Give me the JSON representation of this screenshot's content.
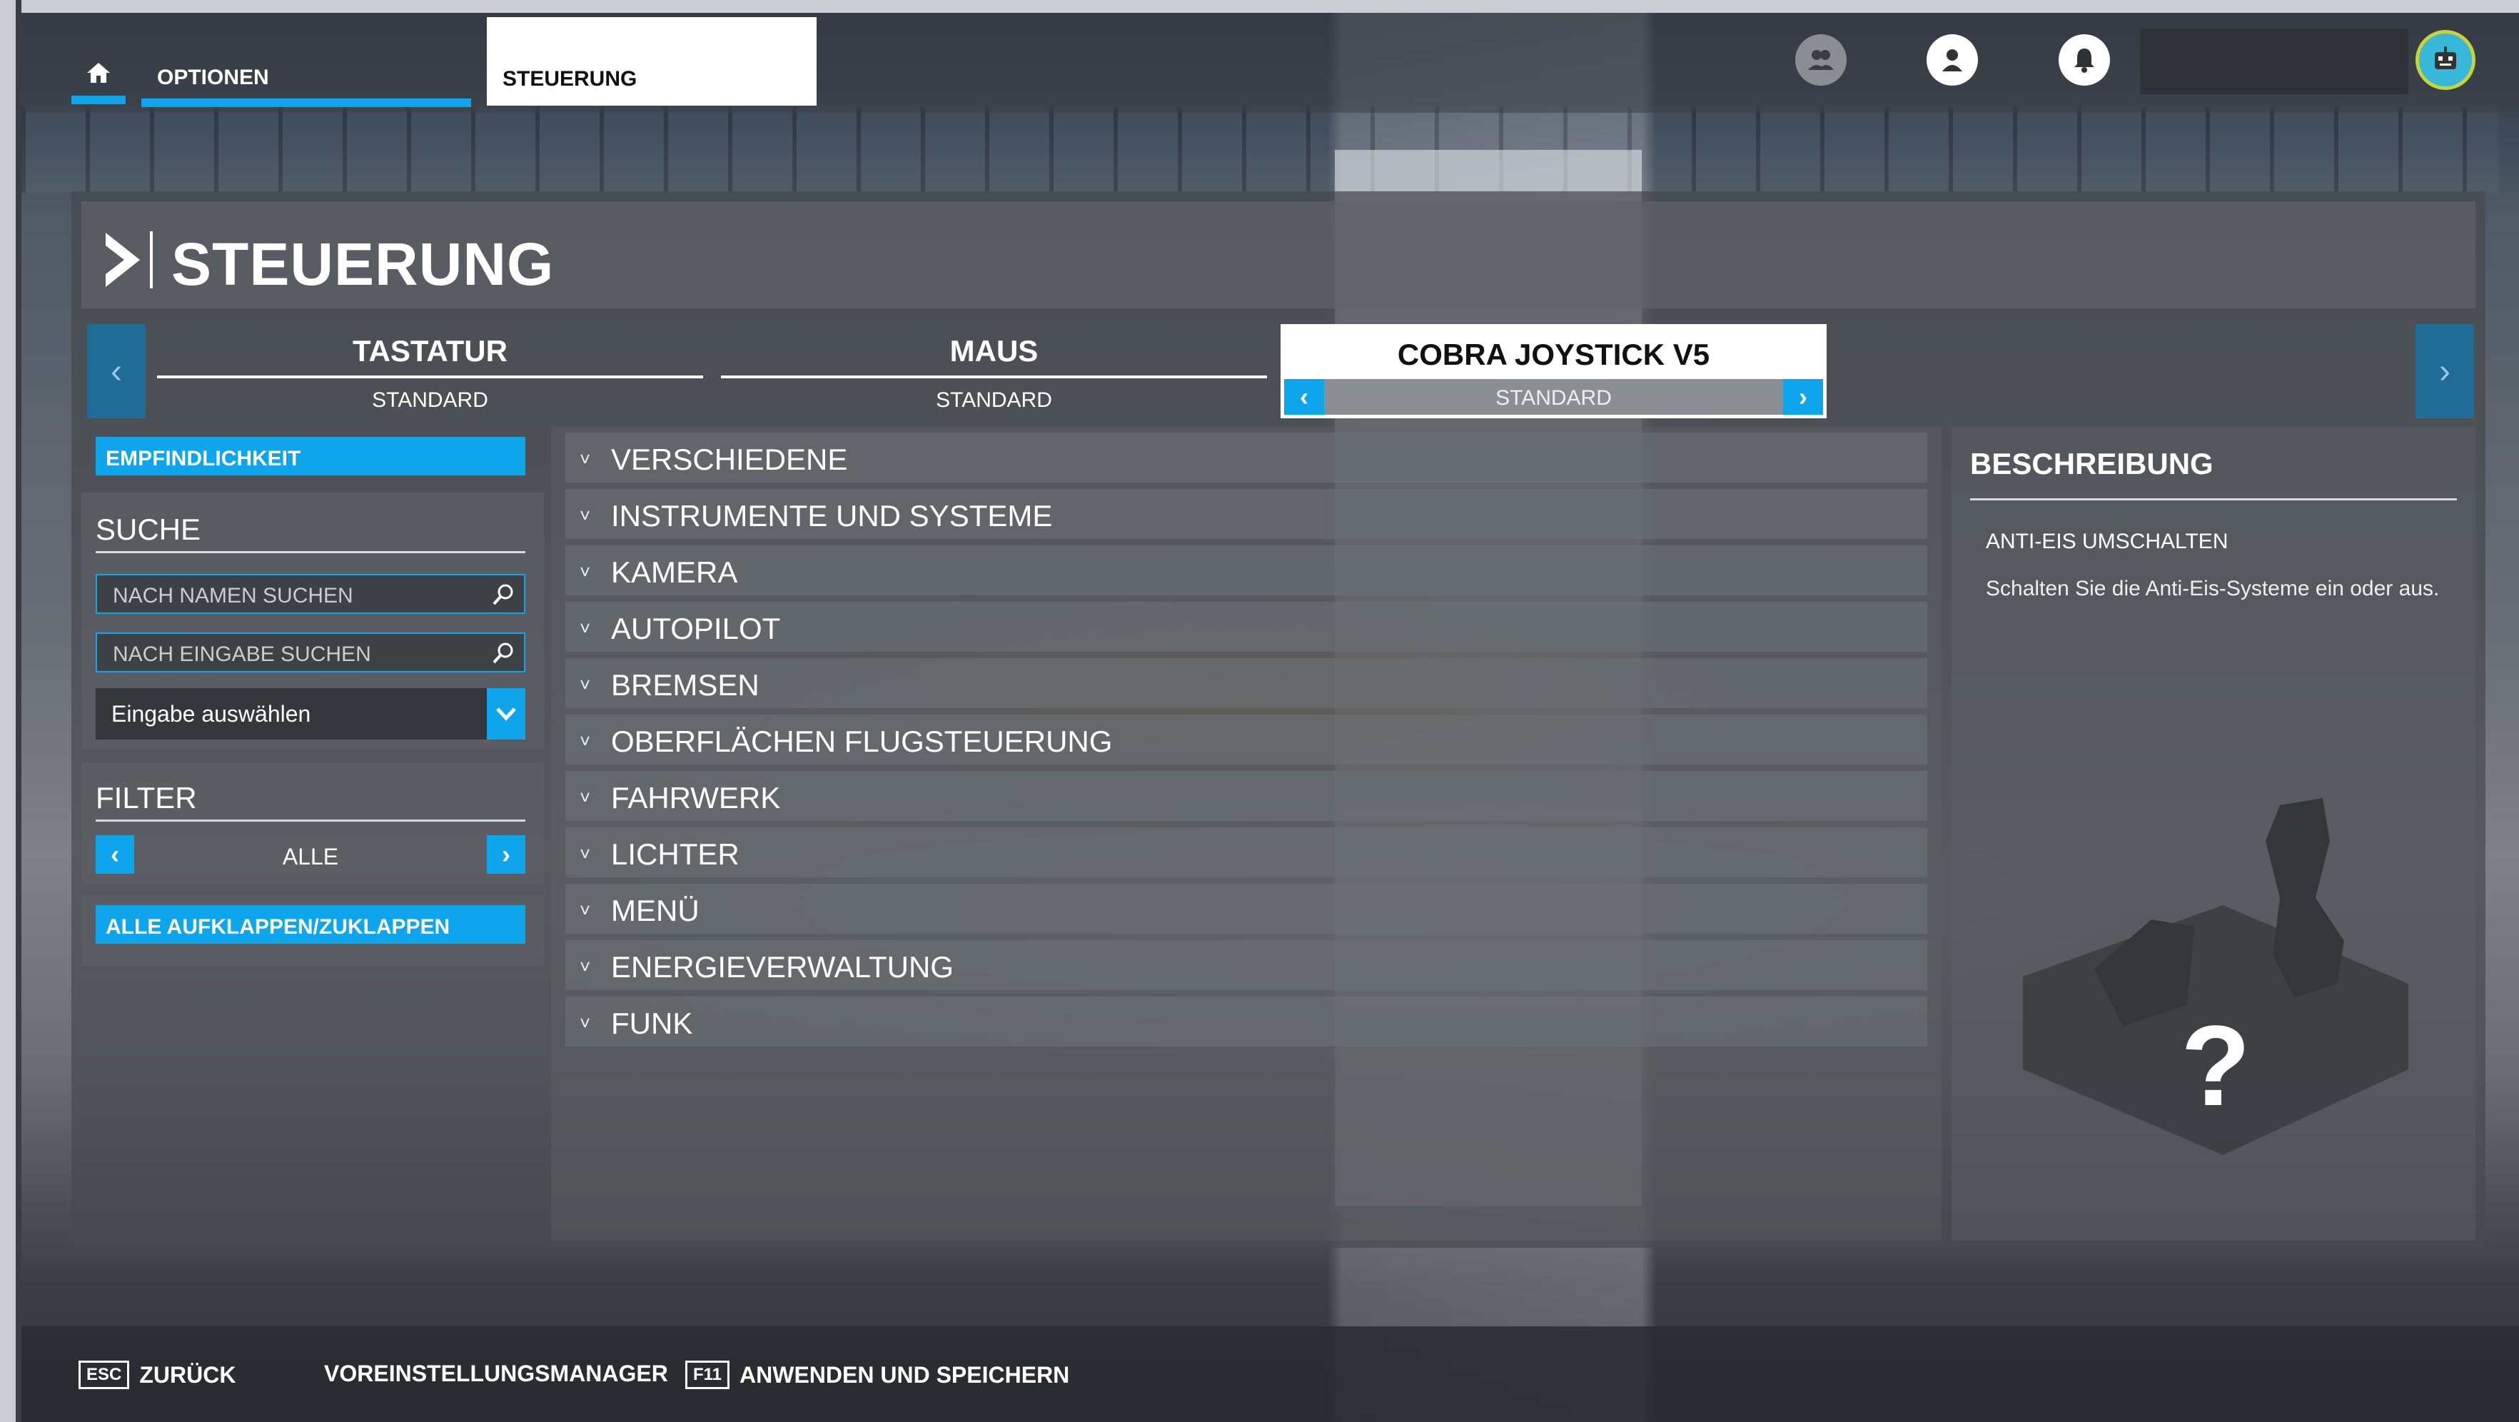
{
  "topbar": {
    "home_icon": "home-icon",
    "tab_options": "OPTIONEN",
    "tab_controls": "STEUERUNG",
    "icons": [
      "friends-icon",
      "profile-icon",
      "notification-icon"
    ],
    "username": "",
    "avatar_icon": "avatar-robot-icon"
  },
  "page": {
    "title": "STEUERUNG"
  },
  "devices": [
    {
      "name": "TASTATUR",
      "profile": "STANDARD"
    },
    {
      "name": "MAUS",
      "profile": "STANDARD"
    },
    {
      "name": "COBRA JOYSTICK V5",
      "profile": "STANDARD",
      "active": true
    }
  ],
  "left": {
    "sensitivity": "EMPFINDLICHKEIT",
    "search_title": "SUCHE",
    "search_name_placeholder": "NACH NAMEN SUCHEN",
    "search_input_placeholder": "NACH EINGABE SUCHEN",
    "select_input": "Eingabe auswählen",
    "filter_title": "FILTER",
    "filter_value": "ALLE",
    "expand_all": "ALLE AUFKLAPPEN/ZUKLAPPEN"
  },
  "categories": [
    "VERSCHIEDENE",
    "INSTRUMENTE UND SYSTEME",
    "KAMERA",
    "AUTOPILOT",
    "BREMSEN",
    "OBERFLÄCHEN FLUGSTEUERUNG",
    "FAHRWERK",
    "LICHTER",
    "MENÜ",
    "ENERGIEVERWALTUNG",
    "FUNK"
  ],
  "description": {
    "title": "BESCHREIBUNG",
    "heading": "ANTI-EIS UMSCHALTEN",
    "text": "Schalten Sie die Anti-Eis-Systeme ein oder aus.",
    "image_mark": "?"
  },
  "bottom": {
    "back_key": "ESC",
    "back_label": "ZURÜCK",
    "preset_manager": "VOREINSTELLUNGSMANAGER",
    "apply_key": "F11",
    "apply_label": "ANWENDEN UND SPEICHERN"
  },
  "colors": {
    "accent": "#0ea5ec",
    "panel": "#46494e"
  }
}
